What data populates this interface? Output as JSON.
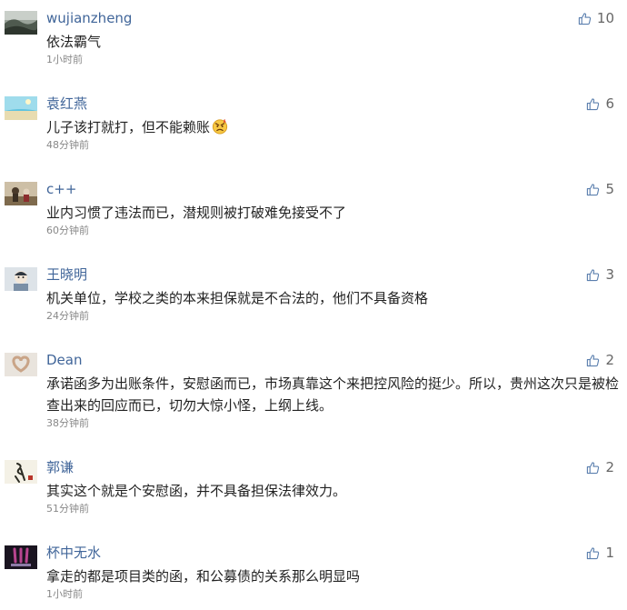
{
  "colors": {
    "username": "#406599",
    "text": "#222222",
    "time": "#888888",
    "like": "#666666"
  },
  "comments": [
    {
      "user": "wujianzheng",
      "text": "依法霸气",
      "time": "1小时前",
      "likes": "10",
      "avatar_icon": "landscape-avatar-icon"
    },
    {
      "user": "袁红燕",
      "text": "儿子该打就打，但不能赖账",
      "time": "48分钟前",
      "likes": "6",
      "avatar_icon": "beach-avatar-icon",
      "emoji_icon": "angry-face-emoji-icon"
    },
    {
      "user": "c++",
      "text": "业内习惯了违法而已，潜规则被打破难免接受不了",
      "time": "60分钟前",
      "likes": "5",
      "avatar_icon": "people-photo-avatar-icon"
    },
    {
      "user": "王晓明",
      "text": "机关单位，学校之类的本来担保就是不合法的，他们不具备资格",
      "time": "24分钟前",
      "likes": "3",
      "avatar_icon": "cartoon-avatar-icon"
    },
    {
      "user": "Dean",
      "text": "承诺函多为出账条件，安慰函而已，市场真靠这个来把控风险的挺少。所以，贵州这次只是被检查出来的回应而已，切勿大惊小怪，上纲上线。",
      "time": "38分钟前",
      "likes": "2",
      "avatar_icon": "heart-hands-avatar-icon"
    },
    {
      "user": "郭谦",
      "text": "其实这个就是个安慰函，并不具备担保法律效力。",
      "time": "51分钟前",
      "likes": "2",
      "avatar_icon": "calligraphy-avatar-icon"
    },
    {
      "user": "杯中无水",
      "text": "拿走的都是项目类的函，和公募债的关系那么明显吗",
      "time": "1小时前",
      "likes": "1",
      "avatar_icon": "monster-logo-avatar-icon"
    }
  ]
}
